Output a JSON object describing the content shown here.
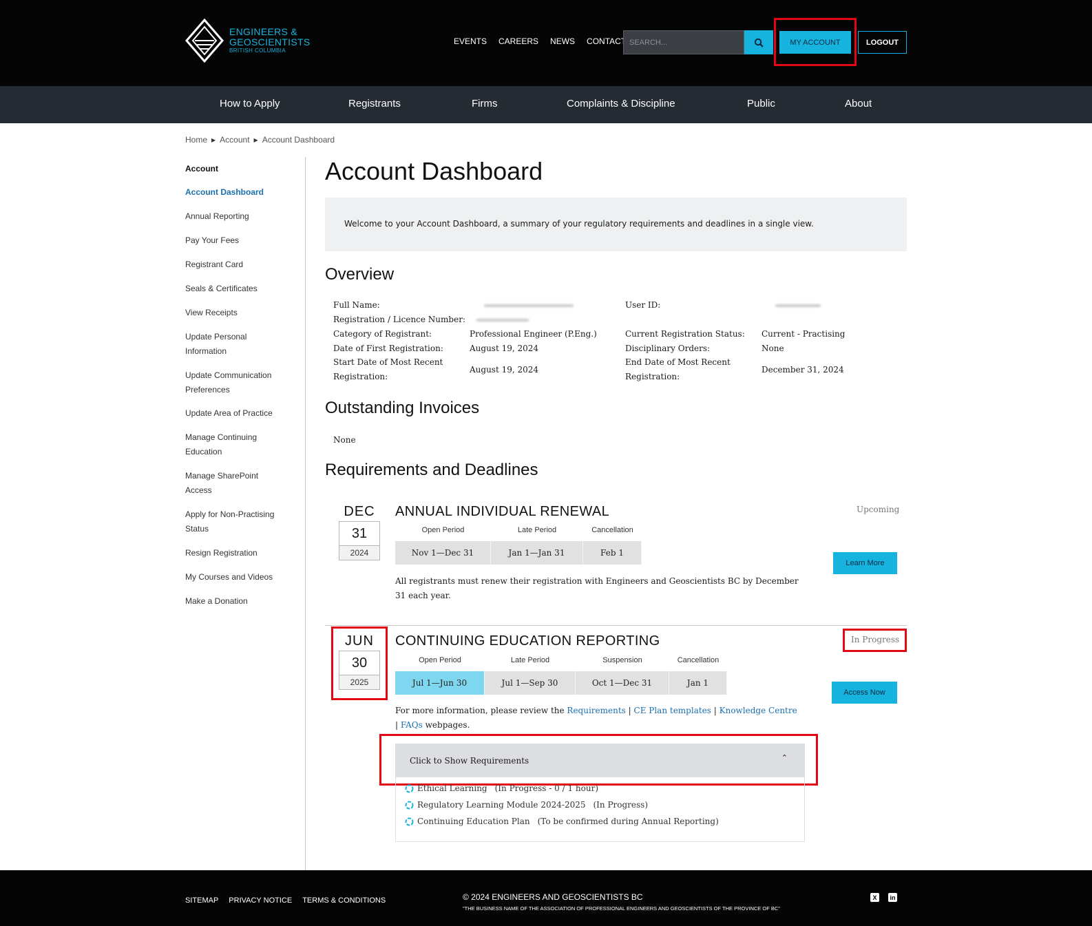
{
  "brand": {
    "line1": "ENGINEERS &",
    "line2": "GEOSCIENTISTS",
    "line3": "BRITISH COLUMBIA",
    "accent": "#17b3df"
  },
  "header": {
    "links": [
      "EVENTS",
      "CAREERS",
      "NEWS",
      "CONTACT"
    ],
    "search_placeholder": "SEARCH...",
    "my_account": "MY ACCOUNT",
    "logout": "LOGOUT"
  },
  "nav": [
    "How to Apply",
    "Registrants",
    "Firms",
    "Complaints & Discipline",
    "Public",
    "About"
  ],
  "breadcrumb": [
    "Home",
    "Account",
    "Account Dashboard"
  ],
  "sidebar": {
    "title": "Account",
    "items": [
      {
        "label": "Account Dashboard"
      },
      {
        "label": "Annual Reporting"
      },
      {
        "label": "Pay Your Fees"
      },
      {
        "label": "Registrant Card"
      },
      {
        "label": "Seals & Certificates"
      },
      {
        "label": "View Receipts"
      },
      {
        "label": "Update Personal Information"
      },
      {
        "label": "Update Communication Preferences"
      },
      {
        "label": "Update Area of Practice"
      },
      {
        "label": "Manage Continuing Education"
      },
      {
        "label": "Manage SharePoint Access"
      },
      {
        "label": "Apply for Non-Practising Status"
      },
      {
        "label": "Resign Registration"
      },
      {
        "label": "My Courses and Videos"
      },
      {
        "label": "Make a Donation"
      }
    ]
  },
  "main": {
    "title": "Account Dashboard",
    "welcome": "Welcome to your Account Dashboard, a summary of your regulatory requirements and deadlines in a single view.",
    "overview": {
      "heading": "Overview",
      "full_name_label": "Full Name:",
      "reg_number_label": "Registration / Licence Number:",
      "category_label": "Category of Registrant:",
      "category_value": "Professional Engineer (P.Eng.)",
      "first_reg_label": "Date of First Registration:",
      "first_reg_value": "August 19, 2024",
      "start_label_1": "Start Date of Most Recent",
      "start_label_2": "Registration:",
      "start_value": "August 19, 2024",
      "user_id_label": "User ID:",
      "status_label": "Current Registration Status:",
      "status_value": "Current - Practising",
      "disc_label": "Disciplinary Orders:",
      "disc_value": "None",
      "end_label_1": "End Date of Most Recent",
      "end_label_2": "Registration:",
      "end_value": "December 31, 2024"
    },
    "invoices": {
      "heading": "Outstanding Invoices",
      "value": "None"
    },
    "requirements_heading": "Requirements and Deadlines",
    "renewal": {
      "month": "DEC",
      "day": "31",
      "year": "2024",
      "title": "ANNUAL INDIVIDUAL RENEWAL",
      "status": "Upcoming",
      "period_labels": [
        "Open Period",
        "Late Period",
        "Cancellation"
      ],
      "period_values": [
        "Nov 1—Dec 31",
        "Jan 1—Jan 31",
        "Feb 1"
      ],
      "description": "All registrants must renew their registration with Engineers and Geoscientists BC by December 31 each year.",
      "button": "Learn More"
    },
    "ce": {
      "month": "JUN",
      "day": "30",
      "year": "2025",
      "title": "CONTINUING EDUCATION REPORTING",
      "status": "In Progress",
      "period_labels": [
        "Open Period",
        "Late Period",
        "Suspension",
        "Cancellation"
      ],
      "period_values": [
        "Jul 1—Jun 30",
        "Jul 1—Sep 30",
        "Oct 1—Dec 31",
        "Jan 1"
      ],
      "desc_prefix": "For more information, please review the",
      "links": [
        "Requirements",
        "CE Plan templates",
        "Knowledge Centre",
        "FAQs"
      ],
      "desc_suffix": "webpages.",
      "button": "Access Now",
      "accordion_label": "Click to Show Requirements",
      "req_items": [
        {
          "name": "Ethical Learning",
          "status": "(In Progress - 0 / 1 hour)"
        },
        {
          "name": "Regulatory Learning Module 2024-2025",
          "status": "(In Progress)"
        },
        {
          "name": "Continuing Education Plan",
          "status": "(To be confirmed during Annual Reporting)"
        }
      ]
    }
  },
  "footer": {
    "links": [
      "SITEMAP",
      "PRIVACY NOTICE",
      "TERMS & CONDITIONS"
    ],
    "copyright": "© 2024 ENGINEERS AND GEOSCIENTISTS BC",
    "legal": "\"THE BUSINESS NAME OF THE ASSOCIATION OF PROFESSIONAL ENGINEERS AND GEOSCIENTISTS OF THE PROVINCE OF BC\"",
    "social": [
      "x-icon",
      "linkedin-icon"
    ]
  }
}
